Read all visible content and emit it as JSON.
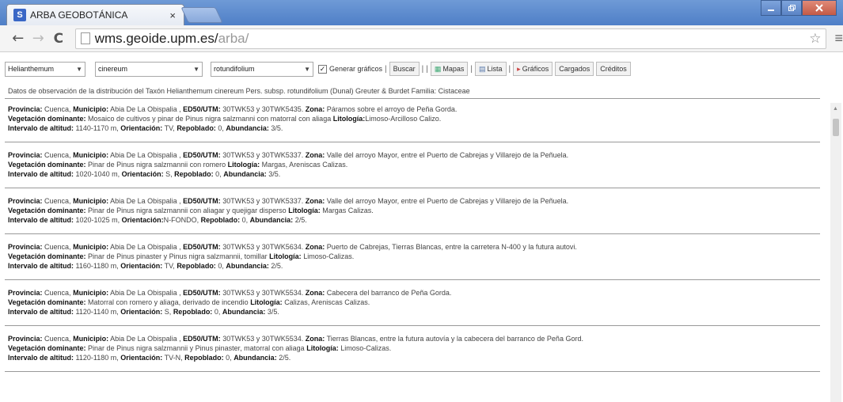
{
  "browser": {
    "tab_title": "ARBA GEOBOTÁNICA",
    "tab_favicon_letter": "S",
    "tab_close": "×",
    "url_host": "wms.geoide.upm.es/",
    "url_path": "arba/",
    "icons": {
      "back": "←",
      "forward": "→",
      "reload": "C",
      "star": "☆",
      "menu": "≡"
    }
  },
  "toolbar": {
    "genus": "Helianthemum",
    "species": "cinereum",
    "subspecies": "rotundifolium",
    "generar_checked": "✓",
    "generar_label": "Generar gráficos",
    "buscar": "Buscar",
    "mapas": "Mapas",
    "lista": "Lista",
    "graficos": "Gráficos",
    "cargados": "Cargados",
    "creditos": "Créditos",
    "sep": "|"
  },
  "taxon_info": "Datos de observación de la distribución del Taxón Helianthemum cinereum Pers. subsp. rotundifolium (Dunal) Greuter & Burdet Familia: Cistaceae",
  "labels": {
    "provincia": "Provincia:",
    "municipio": "Municipio:",
    "ed50": "ED50/UTM:",
    "zona": "Zona:",
    "vegetacion": "Vegetación dominante:",
    "litologia": "Litología:",
    "intervalo": "Intervalo de altitud:",
    "orientacion": "Orientación:",
    "repoblado": "Repoblado:",
    "abundancia": "Abundancia:"
  },
  "records": [
    {
      "provincia": "Cuenca,",
      "municipio": "Abia De La Obispalia ,",
      "ed50": "30TWK53 y 30TWK5435.",
      "zona": "Páramos sobre el arroyo de Peña Gorda.",
      "vegetacion": "Mosaico de cultivos y pinar de Pinus nigra salzmanni con matorral con aliaga",
      "litologia": "Limoso-Arcilloso Calizo.",
      "intervalo": "1140-1170 m,",
      "orientacion": "TV,",
      "repoblado": "0,",
      "abundancia": "3/5."
    },
    {
      "provincia": "Cuenca,",
      "municipio": "Abia De La Obispalia ,",
      "ed50": "30TWK53 y 30TWK5337.",
      "zona": "Valle del arroyo Mayor, entre el Puerto de Cabrejas y Villarejo de la Peñuela.",
      "vegetacion": "Pinar de Pinus nigra salzmannii con romero",
      "litologia": "Margas, Areniscas Calizas.",
      "intervalo": "1020-1040 m,",
      "orientacion": "S,",
      "repoblado": "0,",
      "abundancia": "3/5."
    },
    {
      "provincia": "Cuenca,",
      "municipio": "Abia De La Obispalia ,",
      "ed50": "30TWK53 y 30TWK5337.",
      "zona": "Valle del arroyo Mayor, entre el Puerto de Cabrejas y Villarejo de la Peñuela.",
      "vegetacion": "Pinar de Pinus nigra salzmannii con aliagar y quejigar disperso",
      "litologia": "Margas Calizas.",
      "intervalo": "1020-1025 m,",
      "orientacion": "N-FONDO,",
      "repoblado": "0,",
      "abundancia": "2/5."
    },
    {
      "provincia": "Cuenca,",
      "municipio": "Abia De La Obispalia ,",
      "ed50": "30TWK53 y 30TWK5634.",
      "zona": "Puerto de Cabrejas, Tierras Blancas, entre la carretera N-400 y la futura autovi.",
      "vegetacion": "Pinar de Pinus pinaster y Pinus nigra salzmannii, tomillar",
      "litologia": "Limoso-Calizas.",
      "intervalo": "1160-1180 m,",
      "orientacion": "TV,",
      "repoblado": "0,",
      "abundancia": "2/5."
    },
    {
      "provincia": "Cuenca,",
      "municipio": "Abia De La Obispalia ,",
      "ed50": "30TWK53 y 30TWK5534.",
      "zona": "Cabecera del barranco de Peña Gorda.",
      "vegetacion": "Matorral con romero y aliaga, derivado de incendio",
      "litologia": "Calizas, Areniscas Calizas.",
      "intervalo": "1120-1140 m,",
      "orientacion": "S,",
      "repoblado": "0,",
      "abundancia": "3/5."
    },
    {
      "provincia": "Cuenca,",
      "municipio": "Abia De La Obispalia ,",
      "ed50": "30TWK53 y 30TWK5534.",
      "zona": "Tierras Blancas, entre la futura autovía y la cabecera del barranco de Peña Gord.",
      "vegetacion": "Pinar de Pinus nigra salzmannii y Pinus pinaster, matorral con aliaga",
      "litologia": "Limoso-Calizas.",
      "intervalo": "1120-1180 m,",
      "orientacion": "TV-N,",
      "repoblado": "0,",
      "abundancia": "2/5."
    }
  ]
}
